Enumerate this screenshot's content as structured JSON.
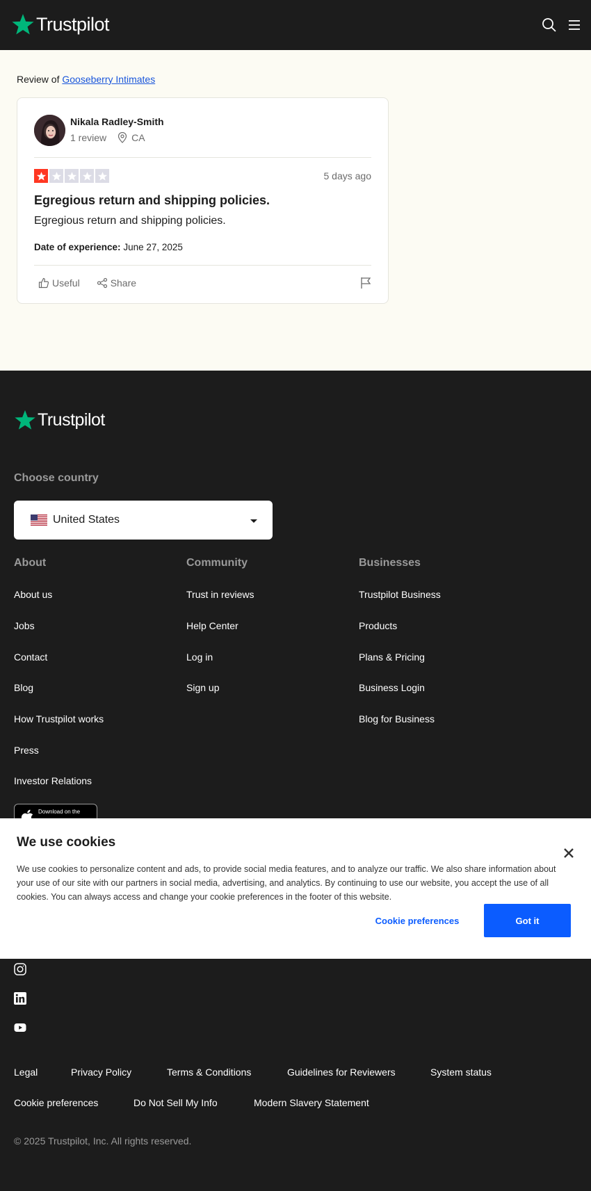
{
  "header": {
    "logo_text": "Trustpilot",
    "brand_color": "#00b67a",
    "icons": [
      "search-icon",
      "menu-icon"
    ]
  },
  "review": {
    "review_of_prefix": "Review of",
    "business_name": "Gooseberry Intimates",
    "reviewer": {
      "name": "Nikala Radley-Smith",
      "review_count": "1 review",
      "country": "CA"
    },
    "rating": 1,
    "rating_max": 5,
    "date": "5 days ago",
    "title": "Egregious return and shipping policies.",
    "body": "Egregious return and shipping policies.",
    "experience_label": "Date of experience:",
    "experience_date": "June 27, 2025",
    "useful_label": "Useful",
    "share_label": "Share"
  },
  "footer": {
    "logo_text": "Trustpilot",
    "choose_country_label": "Choose country",
    "country": "United States",
    "columns": [
      {
        "heading": "About",
        "links": [
          "About us",
          "Jobs",
          "Contact",
          "Blog",
          "How Trustpilot works",
          "Press",
          "Investor Relations"
        ]
      },
      {
        "heading": "Community",
        "links": [
          "Trust in reviews",
          "Help Center",
          "Log in",
          "Sign up"
        ]
      },
      {
        "heading": "Businesses",
        "links": [
          "Trustpilot Business",
          "Products",
          "Plans & Pricing",
          "Business Login",
          "Blog for Business"
        ]
      }
    ],
    "app_store_small": "Download on the",
    "social_icons": [
      "instagram-icon",
      "linkedin-icon",
      "youtube-icon"
    ],
    "legal_links": [
      "Legal",
      "Privacy Policy",
      "Terms & Conditions",
      "Guidelines for Reviewers",
      "System status",
      "Cookie preferences",
      "Do Not Sell My Info",
      "Modern Slavery Statement"
    ],
    "copyright": "© 2025 Trustpilot, Inc. All rights reserved."
  },
  "cookie_banner": {
    "title": "We use cookies",
    "text": "We use cookies to personalize content and ads, to provide social media features, and to analyze our traffic. We also share information about your use of our site with our partners in social media, advertising, and analytics. By continuing to use our website, you accept the use of all cookies. You can always access and change your cookie preferences in the footer of this website.",
    "preferences_label": "Cookie preferences",
    "accept_label": "Got it",
    "accent_color": "#0b5cff"
  }
}
